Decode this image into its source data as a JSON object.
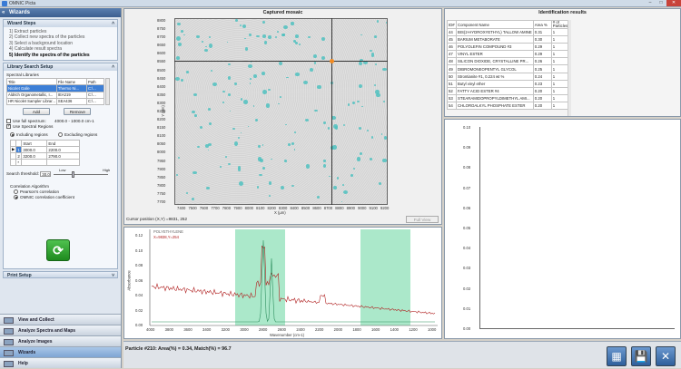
{
  "app": {
    "title": "OMNIC Picta",
    "min": "–",
    "max": "□",
    "close": "✕"
  },
  "left": {
    "header": "Wizards",
    "steps_title": "Wizard Steps",
    "steps": [
      "1) Extract particles",
      "2) Collect new spectra of the particles",
      "3) Select a background location",
      "4) Calculate result spectra",
      "5) Identify the spectra of the particles"
    ],
    "lib_title": "Library Search Setup",
    "spectral_libraries": "Spectral Libraries",
    "lib_cols": [
      "Title",
      "File Name",
      "Path"
    ],
    "lib_rows": [
      [
        "Nicolet Galle",
        "Thermo Ni...",
        "C:\\..."
      ],
      [
        "Aldrich Organometallic, I...",
        "IEA219",
        "C:\\..."
      ],
      [
        "HR Nicolet Sampler Librar...",
        "SEA436",
        "C:\\..."
      ]
    ],
    "add": "Add",
    "remove": "Remove",
    "use_full": "Use full spectrum:",
    "full_range": "4000.0 - 1000.0 cm-1",
    "use_regions": "Use Spectral Regions",
    "including": "Including regions",
    "excluding": "Excluding regions",
    "reg_cols": [
      "",
      "",
      "Start",
      "End"
    ],
    "reg_rows": [
      [
        "▶",
        "1",
        "3000.0",
        "2200.0"
      ],
      [
        "",
        "2",
        "3200.0",
        "2790.0"
      ],
      [
        "",
        "*",
        "",
        ""
      ]
    ],
    "threshold_label": "Search threshold:",
    "threshold_val": "30.0",
    "low": "Low",
    "high": "High",
    "corr_title": "Correlation Algorithm",
    "pearson": "Pearson's correlation",
    "omnic_corr": "OMNIC correlation coefficient",
    "go": "⟳",
    "print_setup": "Print Setup",
    "nav": [
      "View and Collect",
      "Analyze Spectra and Maps",
      "Analyze Images",
      "Wizards",
      "Help"
    ]
  },
  "mosaic": {
    "title": "Captured mosaic",
    "ylabel": "Y (µm)",
    "xlabel": "X (µm)",
    "yticks": [
      "8800",
      "8750",
      "8700",
      "8650",
      "8600",
      "8550",
      "8500",
      "8450",
      "8400",
      "8350",
      "8300",
      "8250",
      "8200",
      "8150",
      "8100",
      "8050",
      "8000",
      "7950",
      "7900",
      "7850",
      "7800",
      "7750",
      "7700"
    ],
    "xticks": [
      "7400",
      "7500",
      "7600",
      "7700",
      "7800",
      "7900",
      "8000",
      "8100",
      "8200",
      "8300",
      "8400",
      "8500",
      "8600",
      "8700",
      "8800",
      "8900",
      "9000",
      "9100",
      "9200"
    ],
    "cursor": "Cursor position (X,Y) =9831, 252",
    "fullview": "Full View"
  },
  "spectrum": {
    "legend1": "POLYETHYLENE",
    "legend2": "X=9838,Y=254",
    "yticks": [
      "0.12",
      "0.10",
      "0.08",
      "0.06",
      "0.04",
      "0.02",
      "0.00"
    ],
    "xticks": [
      "4000",
      "3800",
      "3600",
      "3400",
      "3200",
      "3000",
      "2800",
      "2600",
      "2400",
      "2200",
      "2000",
      "1800",
      "1600",
      "1400",
      "1200",
      "1000"
    ],
    "ylabel": "Absorbance",
    "xlabel": "Wavenumber (cm-1)"
  },
  "ident": {
    "title": "Identification results",
    "cols": [
      "ID#",
      "Component Name",
      "Area %",
      "# of Particles"
    ],
    "rows": [
      [
        "44",
        "BIS(2-HYDROXYETHYL) TALLOW AMINE",
        "0.31",
        "1"
      ],
      [
        "45",
        "BARIUM METABORATE",
        "0.30",
        "1"
      ],
      [
        "46",
        "POLYOLEFIN COMPOUND #3",
        "0.29",
        "1"
      ],
      [
        "47",
        "VINYL ESTER",
        "0.29",
        "1"
      ],
      [
        "48",
        "SILICON DIOXIDE, CRYSTALLINE PR...",
        "0.26",
        "1"
      ],
      [
        "49",
        "DIBROMONEOPENTYL GLYCOL",
        "0.25",
        "1"
      ],
      [
        "50",
        "Strontianite #1, 0.224 wt %",
        "0.24",
        "1"
      ],
      [
        "51",
        "Butyl vinyl ether",
        "0.23",
        "1"
      ],
      [
        "52",
        "FATTY ACID ESTER #4",
        "0.20",
        "1"
      ],
      [
        "53",
        "STEARAMIDOPROPYLDIMETHYL AMI...",
        "0.20",
        "1"
      ],
      [
        "54",
        "CHLOROALKYL PHOSPHATE ESTER",
        "0.20",
        "1"
      ]
    ]
  },
  "rplot": {
    "yticks": [
      "0.10",
      "0.09",
      "0.08",
      "0.07",
      "0.06",
      "0.05",
      "0.04",
      "0.03",
      "0.02",
      "0.01",
      "0.00"
    ]
  },
  "status": {
    "message": "Particle #210: Area(%) = 0.34, Match(%) = 96.7",
    "btn1": "▦",
    "btn2": "💾",
    "btn3": "✕"
  }
}
